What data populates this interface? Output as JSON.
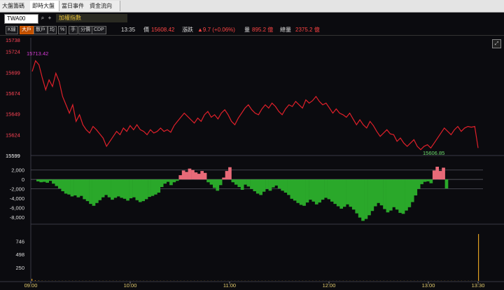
{
  "tabs": [
    {
      "label": "大盤籌碼",
      "active": false
    },
    {
      "label": "即時大盤",
      "active": true
    },
    {
      "label": "當日事件",
      "active": false
    },
    {
      "label": "資金流向",
      "active": false
    }
  ],
  "symbol": {
    "code": "TWA00",
    "name": "加權指數"
  },
  "toolbar": {
    "buttons": [
      "K線",
      "大戶",
      "散戶",
      "均",
      "%",
      "手",
      "分價",
      "CDP"
    ],
    "active": "大戶"
  },
  "quote": {
    "time": "13:35",
    "price_label": "價",
    "price": "15608.42",
    "change_label": "漲跌",
    "change": "▲9.7 (+0.06%)",
    "volume_label": "量",
    "volume": "895.2 億",
    "total_label": "總量",
    "total": "2375.2 億"
  },
  "colors": {
    "price": "#e0202a",
    "up": "#ff3333",
    "green": "#2aa82a",
    "label_up": "#ff4455",
    "label_down": "#ffffff",
    "high_label": "#d63ad6",
    "low_label": "#6ddc6d"
  },
  "chart_data": [
    {
      "type": "line",
      "name": "index",
      "y_ticks": [
        "15738",
        "15724",
        "15699",
        "15674",
        "15649",
        "15624",
        "15599"
      ],
      "ylim": [
        15599,
        15738
      ],
      "annotations": [
        {
          "text": "15713.42"
        },
        {
          "text": "15606.85"
        }
      ],
      "x_ticks": [
        "09:00",
        "10:00",
        "11:00",
        "12:00",
        "13:00",
        "13:30"
      ],
      "xlim": [
        "09:00",
        "13:30"
      ],
      "values": [
        15700,
        15713,
        15708,
        15692,
        15678,
        15690,
        15682,
        15698,
        15688,
        15670,
        15660,
        15650,
        15660,
        15640,
        15648,
        15636,
        15630,
        15626,
        15634,
        15630,
        15625,
        15620,
        15610,
        15616,
        15622,
        15628,
        15624,
        15632,
        15628,
        15635,
        15630,
        15636,
        15630,
        15628,
        15624,
        15630,
        15626,
        15628,
        15632,
        15628,
        15630,
        15627,
        15635,
        15640,
        15645,
        15650,
        15646,
        15642,
        15638,
        15644,
        15640,
        15648,
        15652,
        15645,
        15648,
        15643,
        15650,
        15654,
        15648,
        15640,
        15636,
        15644,
        15650,
        15656,
        15660,
        15654,
        15650,
        15648,
        15655,
        15660,
        15656,
        15662,
        15658,
        15652,
        15648,
        15655,
        15660,
        15658,
        15664,
        15660,
        15656,
        15666,
        15662,
        15665,
        15670,
        15664,
        15660,
        15662,
        15656,
        15650,
        15655,
        15650,
        15648,
        15645,
        15650,
        15643,
        15636,
        15642,
        15636,
        15632,
        15640,
        15635,
        15628,
        15622,
        15626,
        15630,
        15625,
        15624,
        15616,
        15620,
        15614,
        15610,
        15614,
        15618,
        15610,
        15606,
        15610,
        15612,
        15608,
        15614,
        15620,
        15626,
        15632,
        15628,
        15624,
        15630,
        15634,
        15628,
        15632,
        15634,
        15633,
        15634,
        15608
      ]
    },
    {
      "type": "bar",
      "name": "volume-flow",
      "y_ticks": [
        "2,000",
        "0",
        "-2,000",
        "-4,000",
        "-6,000",
        "-8,000"
      ],
      "ylim": [
        -9500,
        3000
      ],
      "values": [
        -400,
        -600,
        -500,
        -700,
        -300,
        -900,
        -1400,
        -1900,
        -2500,
        -3000,
        -3200,
        -3600,
        -3400,
        -3800,
        -3500,
        -4200,
        -4600,
        -5200,
        -5600,
        -5000,
        -4400,
        -3800,
        -3300,
        -3800,
        -4300,
        -3900,
        -3600,
        -3900,
        -4100,
        -4500,
        -4000,
        -3800,
        -4400,
        -4800,
        -4600,
        -4200,
        -3700,
        -3500,
        -3200,
        -2800,
        -1600,
        -900,
        -500,
        -1200,
        -600,
        -300,
        900,
        1900,
        1600,
        2300,
        2000,
        1500,
        1200,
        1800,
        1400,
        -600,
        -1100,
        -1800,
        -2400,
        -1200,
        400,
        1800,
        2600,
        -600,
        -1100,
        -1600,
        -2200,
        -1100,
        -1500,
        -2000,
        -2500,
        -3000,
        -3300,
        -2600,
        -2000,
        -2400,
        -1700,
        -1300,
        -1900,
        -2400,
        -2800,
        -3300,
        -4100,
        -4500,
        -5000,
        -5400,
        -5600,
        -4900,
        -4300,
        -4700,
        -5300,
        -4900,
        -4300,
        -3900,
        -4200,
        -4700,
        -5200,
        -5700,
        -6200,
        -5800,
        -5300,
        -5800,
        -6400,
        -7200,
        -8100,
        -8800,
        -8400,
        -7600,
        -6700,
        -5700,
        -5000,
        -5500,
        -6300,
        -7000,
        -6600,
        -5900,
        -6400,
        -7100,
        -7300,
        -6600,
        -5900,
        -4800,
        -3400,
        -2000,
        -1000,
        -500,
        -400,
        -800,
        1900,
        2700,
        1800,
        2500,
        -1900
      ]
    },
    {
      "type": "bar",
      "name": "volume",
      "y_ticks": [
        "746",
        "498",
        "250"
      ],
      "ylim": [
        0,
        1000
      ],
      "values": [
        40,
        10,
        6,
        4,
        3,
        3,
        2,
        2,
        2,
        2,
        2,
        2,
        2,
        2,
        2,
        2,
        2,
        2,
        2,
        2,
        2,
        2,
        2,
        2,
        2,
        2,
        2,
        2,
        2,
        2,
        2,
        2,
        2,
        2,
        2,
        2,
        2,
        2,
        2,
        2,
        2,
        2,
        2,
        2,
        2,
        2,
        2,
        2,
        2,
        2,
        2,
        2,
        2,
        2,
        2,
        2,
        2,
        2,
        2,
        2,
        2,
        2,
        2,
        2,
        2,
        2,
        2,
        2,
        2,
        2,
        2,
        2,
        2,
        2,
        2,
        2,
        2,
        2,
        2,
        2,
        2,
        2,
        2,
        2,
        2,
        2,
        2,
        2,
        2,
        2,
        2,
        2,
        2,
        2,
        2,
        2,
        2,
        2,
        2,
        2,
        2,
        2,
        2,
        2,
        2,
        2,
        2,
        2,
        2,
        2,
        2,
        2,
        2,
        2,
        2,
        2,
        2,
        2,
        2,
        2,
        2,
        2,
        2,
        2,
        2,
        2,
        2,
        2,
        2,
        2,
        2,
        2,
        880
      ]
    }
  ]
}
